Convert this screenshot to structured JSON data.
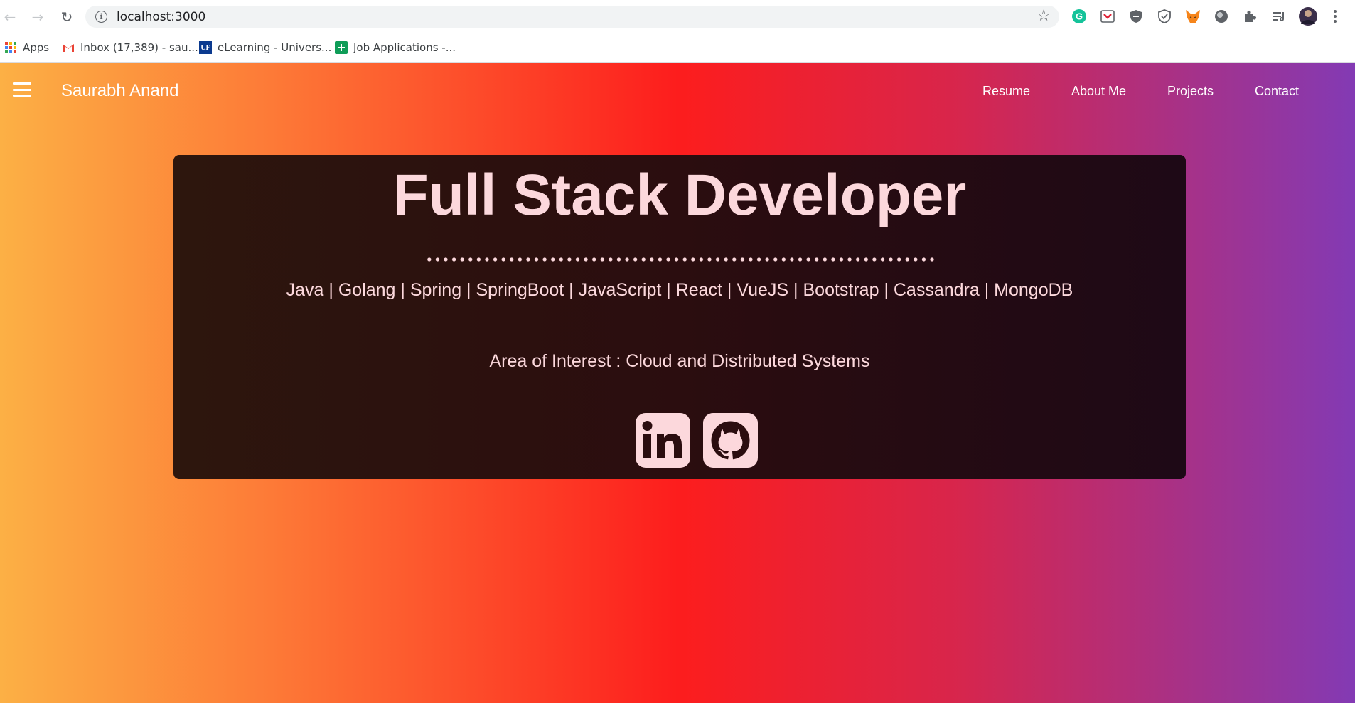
{
  "browser": {
    "url": "localhost:3000",
    "back_icon": "back-arrow-icon",
    "forward_icon": "forward-arrow-icon",
    "reload_icon": "reload-icon",
    "bookmarks": [
      {
        "label": "Apps",
        "icon": "apps-grid-icon"
      },
      {
        "label": "Inbox (17,389) - sau...",
        "icon": "gmail-icon"
      },
      {
        "label": "eLearning - Univers...",
        "icon": "uf-icon"
      },
      {
        "label": "Job Applications -...",
        "icon": "sheets-icon"
      }
    ],
    "extensions": [
      "grammarly-icon",
      "pocket-icon",
      "shield-icon",
      "check-shield-icon",
      "metamask-icon",
      "circle-icon",
      "puzzle-icon",
      "reading-list-icon",
      "profile-avatar",
      "menu-dots-icon"
    ],
    "ext_text": {
      "grammarly": "G",
      "uf": "UF"
    }
  },
  "navbar": {
    "brand": "Saurabh Anand",
    "links": [
      "Resume",
      "About Me",
      "Projects",
      "Contact"
    ]
  },
  "hero": {
    "title": "Full Stack Developer",
    "skills": "Java | Golang | Spring | SpringBoot | JavaScript | React | VueJS | Bootstrap | Cassandra | MongoDB",
    "interest": "Area of Interest : Cloud and Distributed Systems",
    "social": [
      {
        "name": "linkedin-icon",
        "text": "in"
      },
      {
        "name": "github-icon",
        "text": ""
      }
    ]
  },
  "colors": {
    "gradient": [
      "#fcb045",
      "#fd1d1d",
      "#833ab4"
    ],
    "card_text": "#fcd8dc",
    "card_bg": "#2b0d0f"
  }
}
